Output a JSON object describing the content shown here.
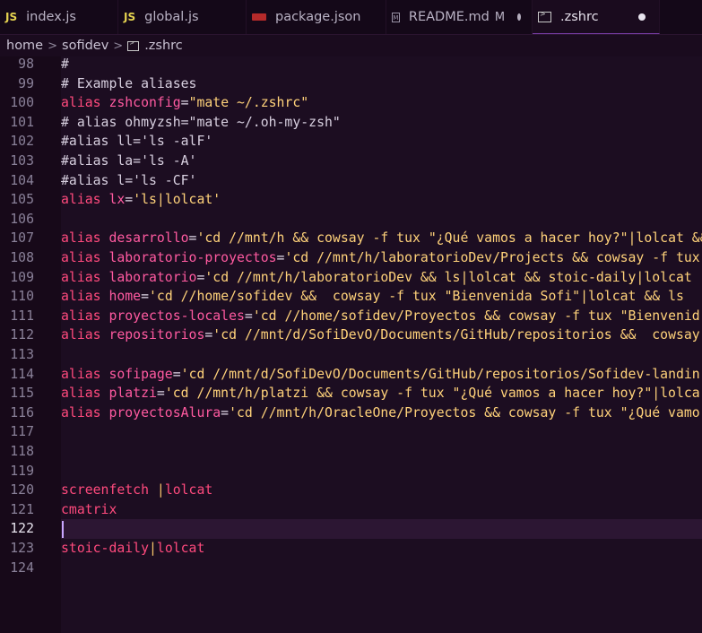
{
  "tabs": [
    {
      "icon": "JS",
      "label": "index.js",
      "type": "js"
    },
    {
      "icon": "JS",
      "label": "global.js",
      "type": "js"
    },
    {
      "icon": "",
      "label": "package.json",
      "type": "pkg"
    },
    {
      "icon": "M↓",
      "label": "README.md",
      "type": "md",
      "flag": "M"
    },
    {
      "icon": "",
      "label": ".zshrc",
      "type": "term",
      "active": true
    }
  ],
  "breadcrumb": {
    "parts": [
      "home",
      "sofidev"
    ],
    "file": ".zshrc"
  },
  "editor": {
    "current_line": 122,
    "lines": [
      {
        "n": 98,
        "segs": [
          [
            "cmt",
            "#"
          ]
        ]
      },
      {
        "n": 99,
        "segs": [
          [
            "cmt",
            "# Example aliases"
          ]
        ]
      },
      {
        "n": 100,
        "segs": [
          [
            "kw",
            "alias "
          ],
          [
            "name",
            "zshconfig"
          ],
          [
            "op",
            "="
          ],
          [
            "str",
            "\"mate ~/.zshrc\""
          ]
        ]
      },
      {
        "n": 101,
        "segs": [
          [
            "cmt",
            "# alias ohmyzsh=\"mate ~/.oh-my-zsh\""
          ]
        ]
      },
      {
        "n": 102,
        "segs": [
          [
            "cmt",
            "#alias ll='ls -alF'"
          ]
        ]
      },
      {
        "n": 103,
        "segs": [
          [
            "cmt",
            "#alias la='ls -A'"
          ]
        ]
      },
      {
        "n": 104,
        "segs": [
          [
            "cmt",
            "#alias l='ls -CF'"
          ]
        ]
      },
      {
        "n": 105,
        "segs": [
          [
            "kw",
            "alias "
          ],
          [
            "name",
            "lx"
          ],
          [
            "op",
            "="
          ],
          [
            "str",
            "'ls|lolcat'"
          ]
        ]
      },
      {
        "n": 106,
        "segs": []
      },
      {
        "n": 107,
        "segs": [
          [
            "kw",
            "alias "
          ],
          [
            "name",
            "desarrollo"
          ],
          [
            "op",
            "="
          ],
          [
            "str",
            "'cd //mnt/h && cowsay -f tux \"¿Qué vamos a hacer hoy?\"|lolcat && "
          ]
        ]
      },
      {
        "n": 108,
        "segs": [
          [
            "kw",
            "alias "
          ],
          [
            "name",
            "laboratorio-proyectos"
          ],
          [
            "op",
            "="
          ],
          [
            "str",
            "'cd //mnt/h/laboratorioDev/Projects && cowsay -f tux"
          ]
        ]
      },
      {
        "n": 109,
        "segs": [
          [
            "kw",
            "alias "
          ],
          [
            "name",
            "laboratorio"
          ],
          [
            "op",
            "="
          ],
          [
            "str",
            "'cd //mnt/h/laboratorioDev && ls|lolcat && stoic-daily|lolcat"
          ]
        ]
      },
      {
        "n": 110,
        "segs": [
          [
            "kw",
            "alias "
          ],
          [
            "name",
            "home"
          ],
          [
            "op",
            "="
          ],
          [
            "str",
            "'cd //home/sofidev &&  cowsay -f tux \"Bienvenida Sofi\"|lolcat && ls "
          ]
        ]
      },
      {
        "n": 111,
        "segs": [
          [
            "kw",
            "alias "
          ],
          [
            "name",
            "proyectos-locales"
          ],
          [
            "op",
            "="
          ],
          [
            "str",
            "'cd //home/sofidev/Proyectos && cowsay -f tux \"Bienvenid"
          ]
        ]
      },
      {
        "n": 112,
        "segs": [
          [
            "kw",
            "alias "
          ],
          [
            "name",
            "repositorios"
          ],
          [
            "op",
            "="
          ],
          [
            "str",
            "'cd //mnt/d/SofiDevO/Documents/GitHub/repositorios &&  cowsay"
          ]
        ]
      },
      {
        "n": 113,
        "segs": []
      },
      {
        "n": 114,
        "segs": [
          [
            "kw",
            "alias "
          ],
          [
            "name",
            "sofipage"
          ],
          [
            "op",
            "="
          ],
          [
            "str",
            "'cd //mnt/d/SofiDevO/Documents/GitHub/repositorios/Sofidev-landin"
          ]
        ]
      },
      {
        "n": 115,
        "segs": [
          [
            "kw",
            "alias "
          ],
          [
            "name",
            "platzi"
          ],
          [
            "op",
            "="
          ],
          [
            "str",
            "'cd //mnt/h/platzi && cowsay -f tux \"¿Qué vamos a hacer hoy?\"|lolca"
          ]
        ]
      },
      {
        "n": 116,
        "segs": [
          [
            "kw",
            "alias "
          ],
          [
            "name",
            "proyectosAlura"
          ],
          [
            "op",
            "="
          ],
          [
            "str",
            "'cd //mnt/h/OracleOne/Proyectos && cowsay -f tux \"¿Qué vamo"
          ]
        ]
      },
      {
        "n": 117,
        "segs": []
      },
      {
        "n": 118,
        "segs": []
      },
      {
        "n": 119,
        "segs": []
      },
      {
        "n": 120,
        "segs": [
          [
            "plain",
            "screenfetch "
          ],
          [
            "pipe",
            "|"
          ],
          [
            "plain",
            "lolcat"
          ]
        ]
      },
      {
        "n": 121,
        "segs": [
          [
            "plain",
            "cmatrix"
          ]
        ]
      },
      {
        "n": 122,
        "segs": []
      },
      {
        "n": 123,
        "segs": [
          [
            "plain",
            "stoic-daily"
          ],
          [
            "pipe",
            "|"
          ],
          [
            "plain",
            "lolcat"
          ]
        ]
      },
      {
        "n": 124,
        "segs": []
      }
    ]
  }
}
